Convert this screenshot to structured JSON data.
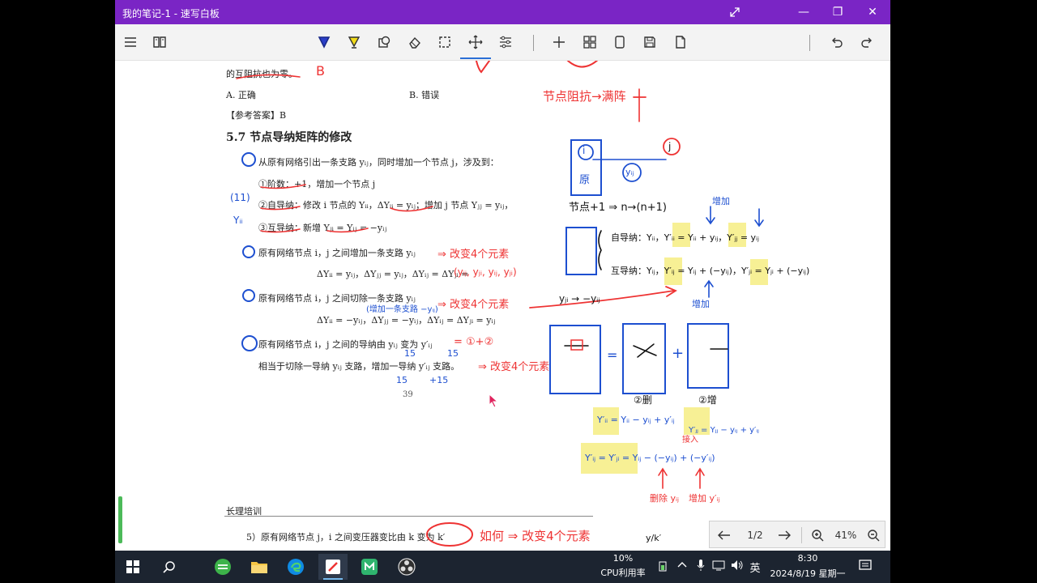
{
  "window": {
    "title": "我的笔记-1 - 速写白板",
    "controls": {
      "expand_icon": "expand-icon",
      "minimize": "—",
      "restore": "❐",
      "close": "✕"
    }
  },
  "toolbar": {
    "left_icons": [
      "menu-icon",
      "book-icon"
    ],
    "tools": [
      "pen-icon",
      "highlighter-icon",
      "shape-icon",
      "eraser-icon",
      "lasso-select-icon",
      "pan-icon",
      "settings-sliders-icon"
    ],
    "insert": [
      "add-icon",
      "grid-icon",
      "page-icon",
      "save-icon",
      "export-icon"
    ],
    "history": [
      "undo-icon",
      "redo-icon"
    ],
    "accent": "#7a25c5",
    "active_tool": "pan-icon"
  },
  "document": {
    "line1": "的互阻抗也为零。",
    "optA": "A.  正确",
    "optB": "B.  错误",
    "answer": "【参考答案】B",
    "heading": "5.7  节点导纳矩阵的修改",
    "p1": "从原有网络引出一条支路 yᵢⱼ，同时增加一个节点 j，涉及到：",
    "p1a": "①阶数：+1，增加一个节点 j",
    "p1b": "②自导纳：修改 i 节点的 Yᵢᵢ，ΔYᵢᵢ = yᵢⱼ；增加 j 节点 Yⱼⱼ = yᵢⱼ，",
    "p1c": "③互导纳：新增 Yⱼᵢ = Yᵢⱼ = −yᵢⱼ",
    "p2": "原有网络节点 i，j 之间增加一条支路 yᵢⱼ",
    "p2eq": "ΔYᵢᵢ = yᵢⱼ，ΔYⱼⱼ = yᵢⱼ，ΔYᵢⱼ = ΔYⱼᵢ =",
    "p3": "原有网络节点 i，j 之间切除一条支路 yᵢⱼ",
    "p3eq": "ΔYᵢᵢ = −yᵢⱼ，ΔYⱼⱼ = −yᵢⱼ，ΔYᵢⱼ = ΔYⱼᵢ = yᵢⱼ",
    "p4": "原有网络节点 i，j 之间的导纳由 yᵢⱼ 变为 y′ᵢⱼ",
    "p4b": "相当于切除一导纳 yᵢⱼ 支路，增加一导纳 y′ᵢⱼ 支路。",
    "page_no": "39",
    "footer_title": "长理培训",
    "p5": "5）原有网络节点 j，i 之间变压器变比由 k 变为 k′"
  },
  "handwriting": {
    "h_B": "B",
    "h_top": "节点阻抗→满阵",
    "h_node_i": "i",
    "h_yuan": "原",
    "h_yij": "yᵢⱼ",
    "h_j_circle": "j",
    "h_n1": "节点+1 ⇒ n→(n+1)",
    "h_zengjia": "增加",
    "h_self": "自导纳：Yᵢᵢ，Y′ᵢᵢ = Yᵢᵢ + yᵢⱼ，Y′ⱼⱼ = yᵢⱼ",
    "h_mutual": "互导纳：Yᵢⱼ，Y′ᵢⱼ = Yᵢⱼ + (−yᵢⱼ)，Y′ⱼᵢ = Yⱼᵢ + (−yᵢⱼ)",
    "h_zengjia2": "增加",
    "h_left_yji": "yⱼᵢ → −yᵢⱼ",
    "h_mod4": "⇒ 改变4个元素",
    "h_triple": "(yᵢⱼ, yⱼᵢ, yᵢⱼ, yⱼᵢ)",
    "h_mod4b": "⇒ 改变4个元素",
    "h_add_branch": "(增加一条支路 −yᵢⱼ)",
    "h_eq": "= ①+②",
    "h_mod4c": "⇒ 改变4个元素",
    "h_15": "15",
    "h_15b": "15",
    "h_15c": "15",
    "h_125": "+15",
    "h_left_11": "(11)",
    "h_left_yii": "Yᵢᵢ",
    "h_cut": "②删",
    "h_add": "②增",
    "h_eqA": "Y′ᵢᵢ = Yᵢᵢ − yᵢⱼ + y′ᵢⱼ",
    "h_eqB": "Y′ⱼⱼ = Yⱼⱼ − yᵢⱼ + y′ᵢⱼ",
    "h_eqC": "Y′ᵢⱼ = Y′ⱼᵢ = Yᵢⱼ − (−yᵢⱼ) + (−y′ᵢⱼ)",
    "h_delete": "删除 yᵢⱼ",
    "h_addy": "增加 y′ᵢⱼ",
    "h_ruru": "如何 ⇒ 改变4个元素",
    "h_yk": "y/k′",
    "h_diagram_eq": "=",
    "h_plus": "+",
    "h_jie": "接入"
  },
  "navigator": {
    "page": "1/2",
    "zoom": "41%"
  },
  "taskbar": {
    "cpu": "10%",
    "cpu_label": "CPU利用率",
    "ime": "英",
    "time": "8:30",
    "date": "2024/8/19 星期一"
  }
}
